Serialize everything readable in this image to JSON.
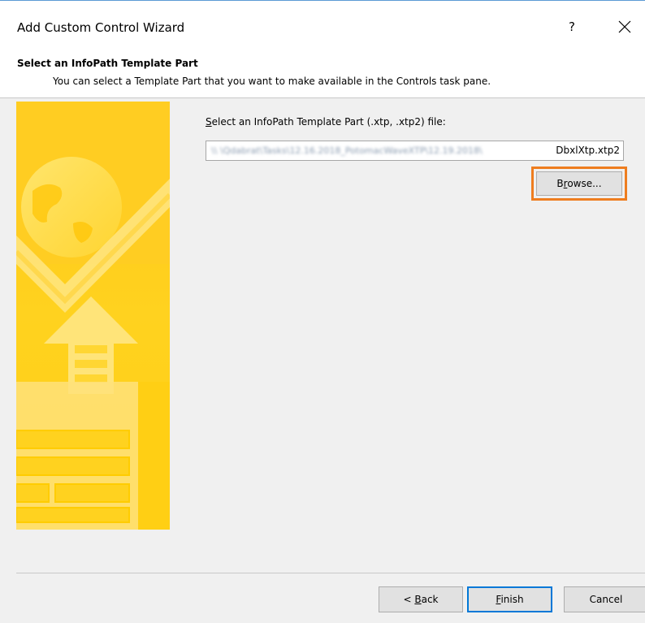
{
  "window": {
    "title": "Add Custom Control Wizard",
    "help_label": "?",
    "close_icon": "close-icon"
  },
  "header": {
    "title": "Select an InfoPath Template Part",
    "description": "You can select a Template Part that you want to make available in the Controls task pane."
  },
  "file_picker": {
    "label_accesskey": "S",
    "label_rest": "elect an InfoPath Template Part (.xtp, .xtp2) file:",
    "path_obscured": "\\\\ \\Qdabrat\\Tasks\\12.16.2018_PotomacWaveXTP\\12.19.2018\\",
    "path_visible": "DbxlXtp.xtp2",
    "browse_pre": "B",
    "browse_accesskey": "r",
    "browse_post": "owse..."
  },
  "buttons": {
    "back_pre": "< ",
    "back_accesskey": "B",
    "back_post": "ack",
    "finish_accesskey": "F",
    "finish_post": "inish",
    "cancel": "Cancel"
  },
  "colors": {
    "highlight": "#ee7d1f",
    "default_button_border": "#0078d7",
    "art_primary": "#ffd200",
    "art_light": "#ffe680"
  }
}
